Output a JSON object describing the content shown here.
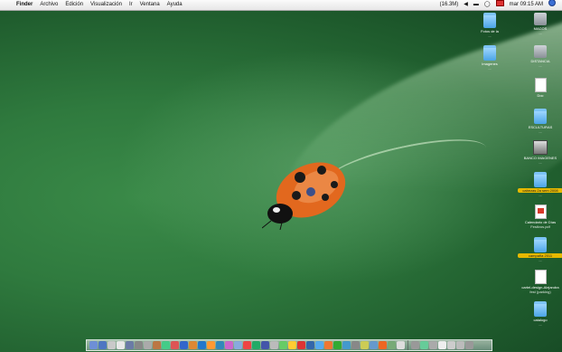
{
  "menubar": {
    "items": [
      {
        "label": "Finder",
        "bold": true
      },
      {
        "label": "Archivo"
      },
      {
        "label": "Edición"
      },
      {
        "label": "Visualización"
      },
      {
        "label": "Ir"
      },
      {
        "label": "Ventana"
      },
      {
        "label": "Ayuda"
      }
    ],
    "battery": "(16.3M)",
    "clock": "mar 09:15 AM"
  },
  "desktop_icons": [
    {
      "type": "folder",
      "label": "Fotos de la",
      "sub": "...",
      "tagged": false
    },
    {
      "type": "drive",
      "label": "MACOS",
      "sub": "...",
      "tagged": false
    },
    {
      "type": "folder",
      "label": "Imagenes",
      "sub": "...",
      "tagged": false
    },
    {
      "type": "drive",
      "label": "DISTANCIA",
      "sub": "...",
      "tagged": false
    },
    {
      "type": "doc",
      "label": "Doc",
      "sub": "",
      "tagged": false
    },
    {
      "type": "folder",
      "label": "ESCULTURAS",
      "sub": "...",
      "tagged": false
    },
    {
      "type": "photo",
      "label": "BANCO IMAGENES",
      "sub": "...",
      "tagged": false
    },
    {
      "type": "folder",
      "label": "cabezas 2a sem 2008",
      "sub": "...",
      "tagged": true
    },
    {
      "type": "pdf",
      "label": "Calendario de Días",
      "sub": "Festivos.pdf",
      "tagged": false
    },
    {
      "type": "folder",
      "label": "campaña 2011",
      "sub": "...",
      "tagged": true
    },
    {
      "type": "doc",
      "label": "cartel-design-Alejandra",
      "sub": "fest (parking)",
      "tagged": false
    },
    {
      "type": "folder",
      "label": "catalogo",
      "sub": "...",
      "tagged": false
    }
  ],
  "dock": {
    "colors": [
      "#6e8fd6",
      "#4e76c2",
      "#c9c9c9",
      "#e8e8e8",
      "#6b7ba6",
      "#888",
      "#aaa",
      "#b74",
      "#4c8",
      "#d55",
      "#36c",
      "#d83",
      "#27c",
      "#f93",
      "#38b",
      "#c6c",
      "#8ad",
      "#e44",
      "#2a6",
      "#45a",
      "#bbb",
      "#6c6",
      "#fc3",
      "#d33",
      "#36a",
      "#5ae",
      "#e73",
      "#3a3",
      "#49c",
      "#888",
      "#cc5",
      "#69c",
      "#e62",
      "#7a7",
      "#ddd",
      "#999",
      "#6c9",
      "#aaa",
      "#eee",
      "#ccc",
      "#bbb",
      "#999"
    ]
  }
}
